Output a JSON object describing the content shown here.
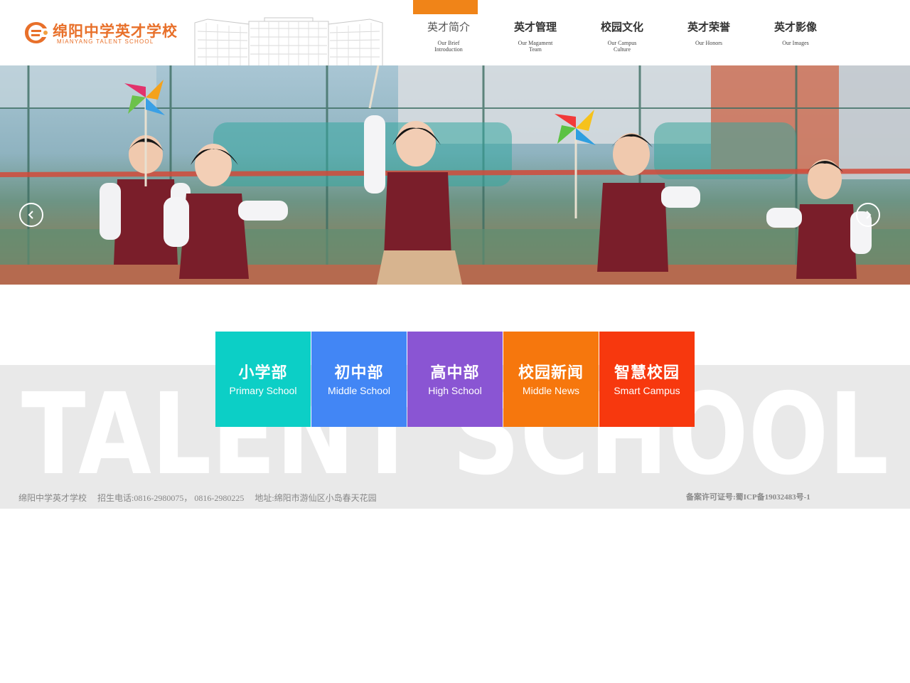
{
  "logo": {
    "name_cn": "绵阳中学英才学校",
    "name_en": "MIANYANG TALENT SCHOOL"
  },
  "nav": [
    {
      "label_cn": "英才简介",
      "label_en_1": "Our Brief",
      "label_en_2": "Introduction",
      "active": true
    },
    {
      "label_cn": "英才管理",
      "label_en_1": "Our Magament",
      "label_en_2": "Team",
      "active": false
    },
    {
      "label_cn": "校园文化",
      "label_en_1": "Our Campus",
      "label_en_2": "Culture",
      "active": false
    },
    {
      "label_cn": "英才荣誉",
      "label_en_1": "Our Honors",
      "label_en_2": "",
      "active": false
    },
    {
      "label_cn": "英才影像",
      "label_en_1": "Our Images",
      "label_en_2": "",
      "active": false
    }
  ],
  "colors": {
    "accent": "#f08418",
    "tile_primary": "#0ccfc6",
    "tile_middle": "#4286f5",
    "tile_high": "#8a55d3",
    "tile_news": "#f6770d",
    "tile_smart": "#f7380e",
    "band": "#e9e9e9"
  },
  "banner": {
    "prev_icon": "chevron-left-icon",
    "next_icon": "chevron-right-icon"
  },
  "watermark": "TALENT SCHOOL",
  "tiles": [
    {
      "label_cn": "小学部",
      "label_en": "Primary School"
    },
    {
      "label_cn": "初中部",
      "label_en": "Middle School"
    },
    {
      "label_cn": "高中部",
      "label_en": "High School"
    },
    {
      "label_cn": "校园新闻",
      "label_en": "Middle News"
    },
    {
      "label_cn": "智慧校园",
      "label_en": "Smart Campus"
    }
  ],
  "footer": {
    "school": "绵阳中学英才学校",
    "phone": "招生电话:0816-2980075， 0816-2980225",
    "address": "地址:绵阳市游仙区小岛春天花园",
    "icp": "备案许可证号:蜀ICP备19032483号-1"
  }
}
